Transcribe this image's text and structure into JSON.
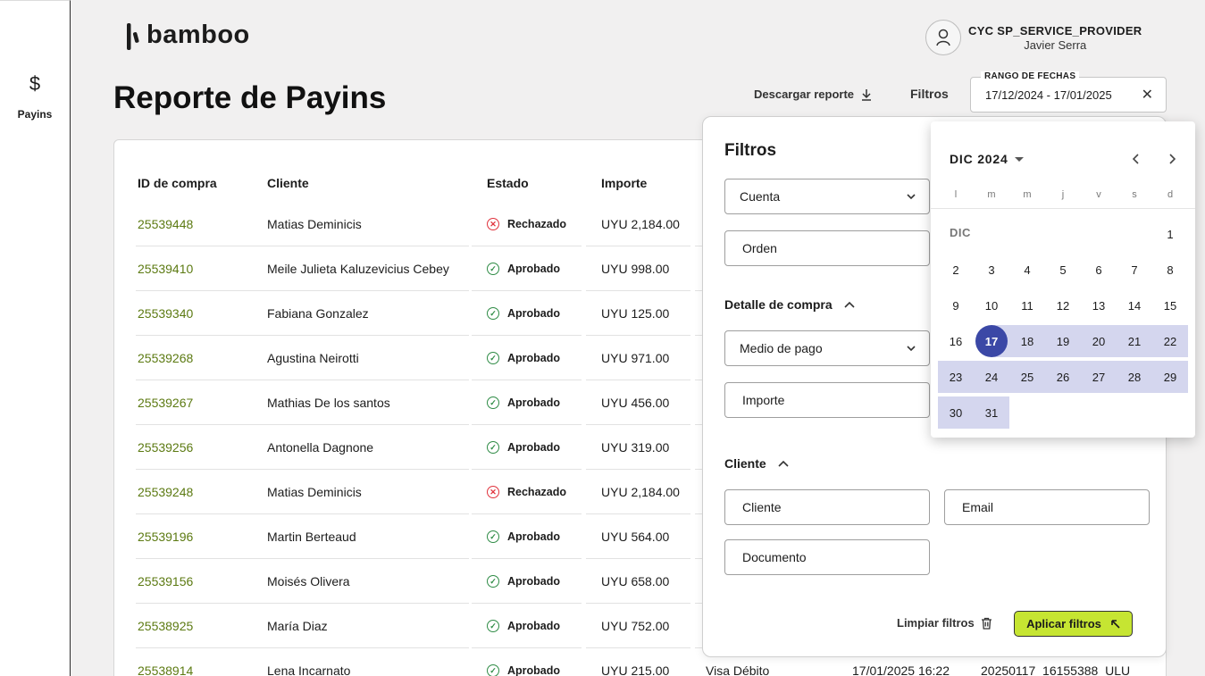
{
  "sidebar": {
    "items": [
      {
        "icon": "$",
        "label": "Payins"
      }
    ]
  },
  "brand": {
    "name": "bamboo"
  },
  "user": {
    "company": "CYC SP_SERVICE_PROVIDER",
    "name": "Javier Serra"
  },
  "page": {
    "title": "Reporte de Payins"
  },
  "toolbar": {
    "download_label": "Descargar reporte",
    "filters_label": "Filtros",
    "date_range": {
      "label": "RANGO DE FECHAS",
      "value": "17/12/2024 - 17/01/2025",
      "clear": "✕"
    }
  },
  "table": {
    "columns": [
      "ID de compra",
      "Cliente",
      "Estado",
      "Importe"
    ],
    "rows": [
      {
        "id": "25539448",
        "client": "Matias Deminicis",
        "status": "Rechazado",
        "status_type": "rejected",
        "amount": "UYU 2,184.00"
      },
      {
        "id": "25539410",
        "client": "Meile Julieta Kaluzevicius Cebey",
        "status": "Aprobado",
        "status_type": "approved",
        "amount": "UYU 998.00"
      },
      {
        "id": "25539340",
        "client": "Fabiana Gonzalez",
        "status": "Aprobado",
        "status_type": "approved",
        "amount": "UYU 125.00"
      },
      {
        "id": "25539268",
        "client": "Agustina Neirotti",
        "status": "Aprobado",
        "status_type": "approved",
        "amount": "UYU 971.00"
      },
      {
        "id": "25539267",
        "client": "Mathias De los santos",
        "status": "Aprobado",
        "status_type": "approved",
        "amount": "UYU 456.00"
      },
      {
        "id": "25539256",
        "client": "Antonella Dagnone",
        "status": "Aprobado",
        "status_type": "approved",
        "amount": "UYU 319.00"
      },
      {
        "id": "25539248",
        "client": "Matias Deminicis",
        "status": "Rechazado",
        "status_type": "rejected",
        "amount": "UYU 2,184.00"
      },
      {
        "id": "25539196",
        "client": "Martin Berteaud",
        "status": "Aprobado",
        "status_type": "approved",
        "amount": "UYU 564.00"
      },
      {
        "id": "25539156",
        "client": "Moisés Olivera",
        "status": "Aprobado",
        "status_type": "approved",
        "amount": "UYU 658.00"
      },
      {
        "id": "25538925",
        "client": "María Diaz",
        "status": "Aprobado",
        "status_type": "approved",
        "amount": "UYU 752.00"
      },
      {
        "id": "25538914",
        "client": "Lena Incarnato",
        "status": "Aprobado",
        "status_type": "approved",
        "amount": "UYU 215.00",
        "method": "Visa Débito",
        "date": "17/01/2025 16:22",
        "ref": "20250117_16155388_ULU"
      }
    ]
  },
  "filters": {
    "title": "Filtros",
    "account_label": "Cuenta",
    "order_label": "Orden",
    "purchase_section": "Detalle de compra",
    "payment_method_label": "Medio de pago",
    "amount_label": "Importe",
    "client_section": "Cliente",
    "client_label": "Cliente",
    "email_label": "Email",
    "document_label": "Documento",
    "clear_label": "Limpiar filtros",
    "apply_label": "Aplicar filtros"
  },
  "calendar": {
    "month_title": "DIC 2024",
    "month_label": "DIC",
    "weekdays": [
      "l",
      "m",
      "m",
      "j",
      "v",
      "s",
      "d"
    ],
    "days": [
      [
        "",
        "",
        "",
        "",
        "",
        "",
        "1"
      ],
      [
        "2",
        "3",
        "4",
        "5",
        "6",
        "7",
        "8"
      ],
      [
        "9",
        "10",
        "11",
        "12",
        "13",
        "14",
        "15"
      ],
      [
        "16",
        "17",
        "18",
        "19",
        "20",
        "21",
        "22"
      ],
      [
        "23",
        "24",
        "25",
        "26",
        "27",
        "28",
        "29"
      ],
      [
        "30",
        "31",
        "",
        "",
        "",
        "",
        ""
      ]
    ],
    "selected_day": "17",
    "range_start_day": "17"
  },
  "colors": {
    "accent_green": "#c6e532",
    "link_green": "#5c7a12",
    "calendar_selected": "#3b48a6",
    "calendar_range": "#d4d6ee",
    "approved": "#2e8b45",
    "rejected": "#e0323c"
  }
}
